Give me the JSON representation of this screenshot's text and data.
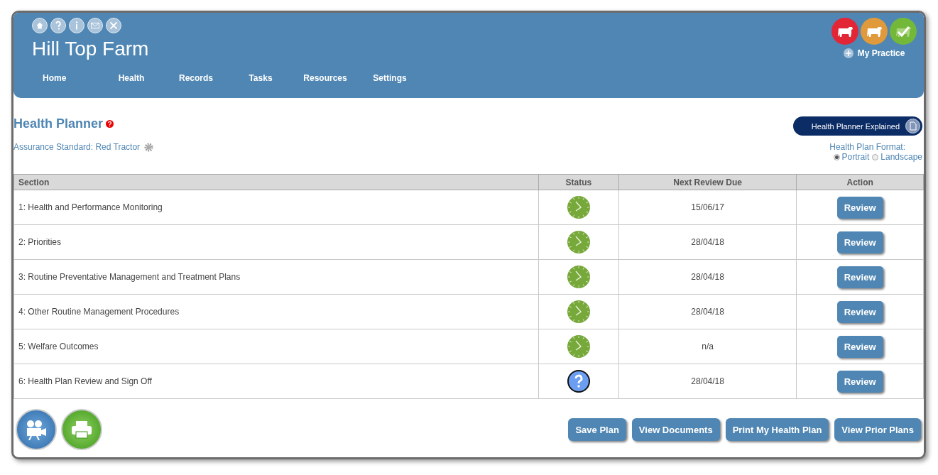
{
  "header": {
    "farm_name": "Hill Top Farm",
    "my_practice": "My Practice",
    "nav": [
      {
        "label": "Home"
      },
      {
        "label": "Health"
      },
      {
        "label": "Records"
      },
      {
        "label": "Tasks"
      },
      {
        "label": "Resources"
      },
      {
        "label": "Settings"
      }
    ],
    "badges": [
      {
        "color": "#e32636"
      },
      {
        "color": "#e09a3c"
      },
      {
        "color": "#74b83a"
      }
    ]
  },
  "planner": {
    "title": "Health Planner",
    "assurance": "Assurance Standard: Red Tractor",
    "explained_button": "Health Planner Explained",
    "format_label": "Health Plan Format:",
    "formats": [
      {
        "label": "Portrait",
        "selected": true
      },
      {
        "label": "Landscape",
        "selected": false
      }
    ]
  },
  "table": {
    "columns": [
      "Section",
      "Status",
      "Next Review Due",
      "Action"
    ],
    "rows": [
      {
        "section": "1: Health and Performance Monitoring",
        "kind": "in-progress",
        "due": "15/06/17",
        "action": "Review"
      },
      {
        "section": "2: Priorities",
        "kind": "in-progress",
        "due": "28/04/18",
        "action": "Review"
      },
      {
        "section": "3: Routine Preventative Management and Treatment Plans",
        "kind": "in-progress",
        "due": "28/04/18",
        "action": "Review"
      },
      {
        "section": "4: Other Routine Management Procedures",
        "kind": "in-progress",
        "due": "28/04/18",
        "action": "Review"
      },
      {
        "section": "5: Welfare Outcomes",
        "kind": "in-progress",
        "due": "n/a",
        "action": "Review"
      },
      {
        "section": "6: Health Plan Review and Sign Off",
        "kind": "unknown",
        "due": "28/04/18",
        "action": "Review"
      }
    ]
  },
  "footer_buttons": [
    "Save Plan",
    "View Documents",
    "Print My Health Plan",
    "View Prior Plans"
  ]
}
